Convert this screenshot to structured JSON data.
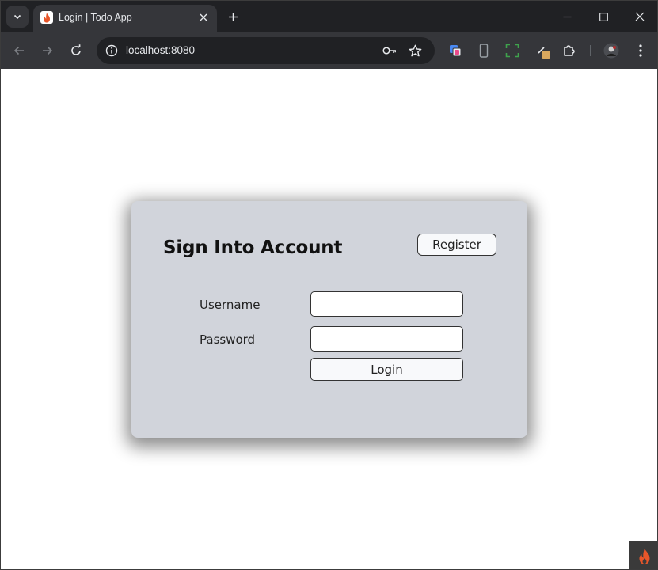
{
  "browser": {
    "tab_title": "Login | Todo App",
    "url": "localhost:8080",
    "icons": {
      "tab_search": "chevron-down-icon",
      "tab_close": "close-icon",
      "new_tab": "plus-icon",
      "minimize": "minimize-icon",
      "maximize": "maximize-icon",
      "close_window": "close-icon",
      "back": "arrow-left-icon",
      "forward": "arrow-right-icon",
      "reload": "reload-icon",
      "site_info": "info-icon",
      "password": "key-icon",
      "bookmark": "star-icon",
      "extensions": "puzzle-icon",
      "menu": "kebab-menu-icon"
    },
    "colors": {
      "titlebar": "#202124",
      "toolbar": "#35363a",
      "accent_flame": "#e8562a"
    }
  },
  "login": {
    "heading": "Sign Into Account",
    "register_label": "Register",
    "username_label": "Username",
    "password_label": "Password",
    "username_value": "",
    "password_value": "",
    "login_label": "Login",
    "colors": {
      "card_background": "#d1d4db",
      "button_background": "#f8f9fb"
    }
  }
}
